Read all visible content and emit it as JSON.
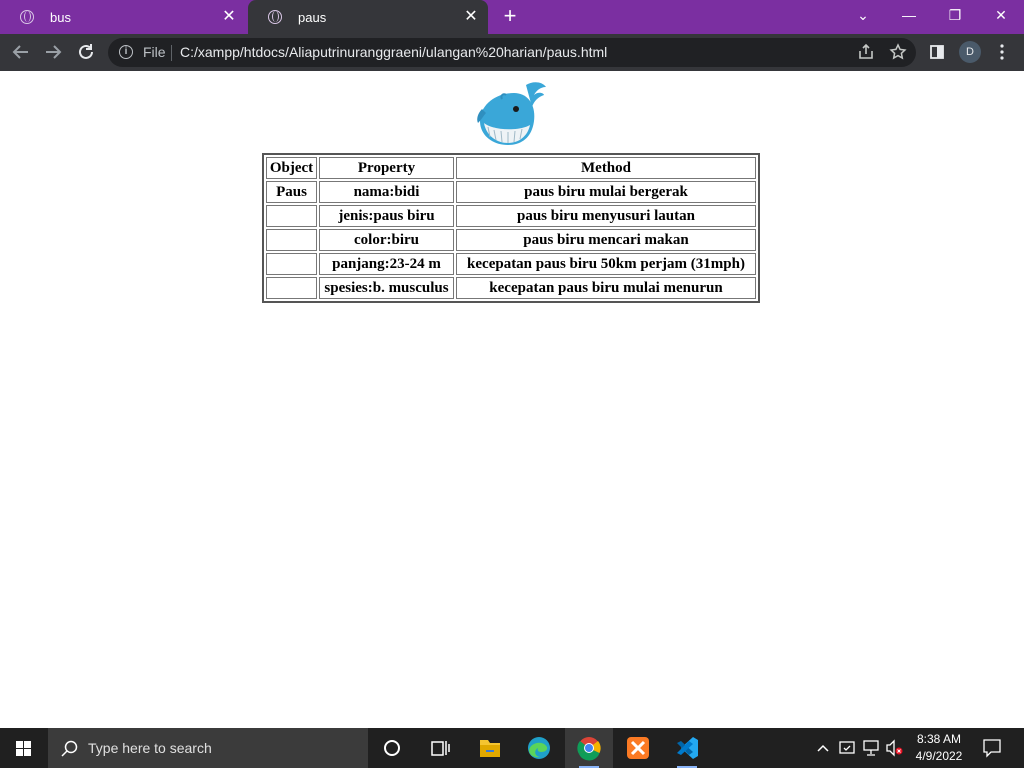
{
  "browser": {
    "tabs": [
      {
        "title": "bus",
        "active": false
      },
      {
        "title": "paus",
        "active": true
      }
    ],
    "close_glyph": "✕",
    "new_tab_glyph": "+",
    "window_controls": {
      "dropdown": "⌄",
      "minimize": "—",
      "restore": "❐",
      "close": "✕"
    },
    "file_label": "File",
    "url": "C:/xampp/htdocs/Aliaputrinuranggraeni/ulangan%20harian/paus.html",
    "profile_initial": "D",
    "colors": {
      "titlebar": "#7b2fa1",
      "toolbar": "#35363a",
      "omnibox": "#202124"
    }
  },
  "page": {
    "image_icon": "whale-emoji",
    "table": {
      "headers": [
        "Object",
        "Property",
        "Method"
      ],
      "rows": [
        [
          "Paus",
          "nama:bidi",
          "paus biru mulai bergerak"
        ],
        [
          "",
          "jenis:paus biru",
          "paus biru menyusuri lautan"
        ],
        [
          "",
          "color:biru",
          "paus biru mencari makan"
        ],
        [
          "",
          "panjang:23-24 m",
          "kecepatan paus biru 50km perjam (31mph)"
        ],
        [
          "",
          "spesies:b. musculus",
          "kecepatan paus biru mulai menurun"
        ]
      ]
    }
  },
  "taskbar": {
    "search_placeholder": "Type here to search",
    "time": "8:38 AM",
    "date": "4/9/2022"
  }
}
